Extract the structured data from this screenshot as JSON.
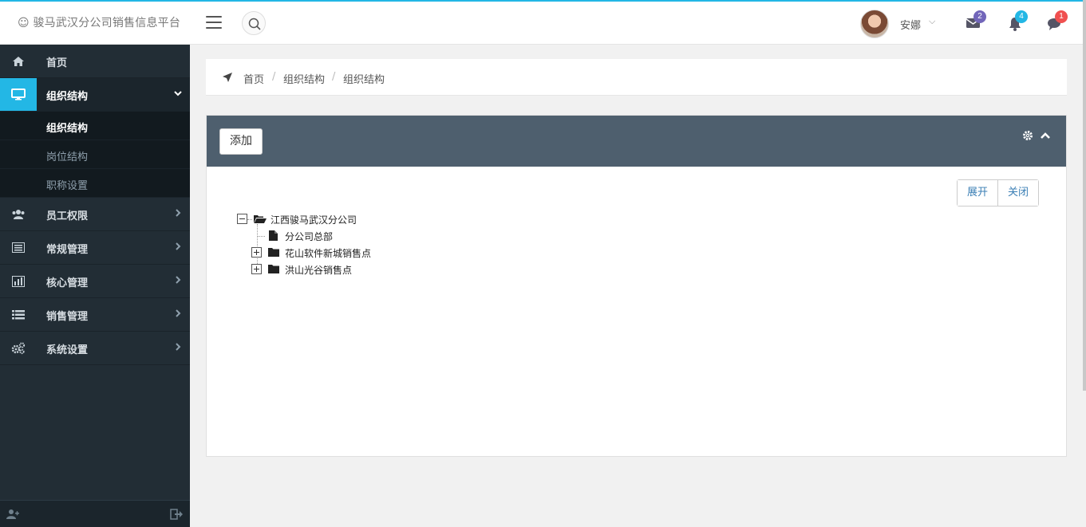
{
  "header": {
    "brand": "☺ 骏马武汉分公司销售信息平台",
    "user_name": "安娜",
    "badges": {
      "mail": "2",
      "notifications": "4",
      "chat": "1"
    },
    "badge_colors": {
      "mail": "#7266ba",
      "notifications": "#23b7e5",
      "chat": "#f05050"
    }
  },
  "sidebar": {
    "items": [
      {
        "label": "首页",
        "icon": "home-icon"
      },
      {
        "label": "组织结构",
        "icon": "desktop-icon",
        "active": true
      },
      {
        "label": "员工权限",
        "icon": "users-icon"
      },
      {
        "label": "常规管理",
        "icon": "list-alt-icon"
      },
      {
        "label": "核心管理",
        "icon": "bar-chart-icon"
      },
      {
        "label": "销售管理",
        "icon": "list-icon"
      },
      {
        "label": "系统设置",
        "icon": "cogs-icon"
      }
    ],
    "sub_items": [
      {
        "label": "组织结构",
        "current": true
      },
      {
        "label": "岗位结构"
      },
      {
        "label": "职称设置"
      }
    ]
  },
  "breadcrumb": {
    "items": [
      "首页",
      "组织结构",
      "组织结构"
    ],
    "separator": "/"
  },
  "panel": {
    "add_label": "添加",
    "expand_label": "展开",
    "close_label": "关闭"
  },
  "tree": {
    "root": "江西骏马武汉分公司",
    "children": [
      {
        "label": "分公司总部",
        "type": "file"
      },
      {
        "label": "花山软件新城销售点",
        "type": "folder"
      },
      {
        "label": "洪山光谷销售点",
        "type": "folder"
      }
    ]
  }
}
